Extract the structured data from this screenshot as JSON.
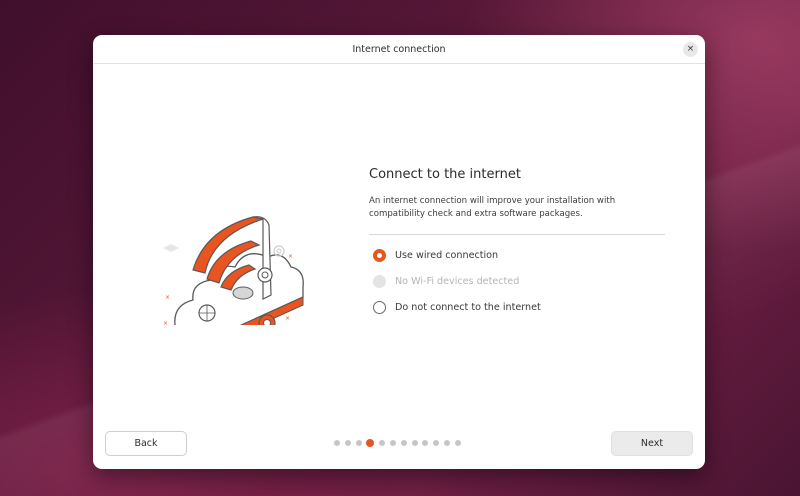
{
  "window": {
    "title": "Internet connection",
    "close_symbol": "×"
  },
  "content": {
    "heading": "Connect to the internet",
    "description": "An internet connection will improve your installation with compatibility check and extra software packages."
  },
  "options": [
    {
      "label": "Use wired connection",
      "checked": true,
      "disabled": false
    },
    {
      "label": "No Wi-Fi devices detected",
      "checked": false,
      "disabled": true
    },
    {
      "label": "Do not connect to the internet",
      "checked": false,
      "disabled": false
    }
  ],
  "footer": {
    "back_label": "Back",
    "next_label": "Next",
    "page_count": 12,
    "current_page": 4
  },
  "icons": {
    "illustration": "wifi-cloud-illustration",
    "close": "close-icon"
  },
  "colors": {
    "accent": "#e95420",
    "window_bg": "#ffffff",
    "wallpaper": "#5a1a3c"
  }
}
